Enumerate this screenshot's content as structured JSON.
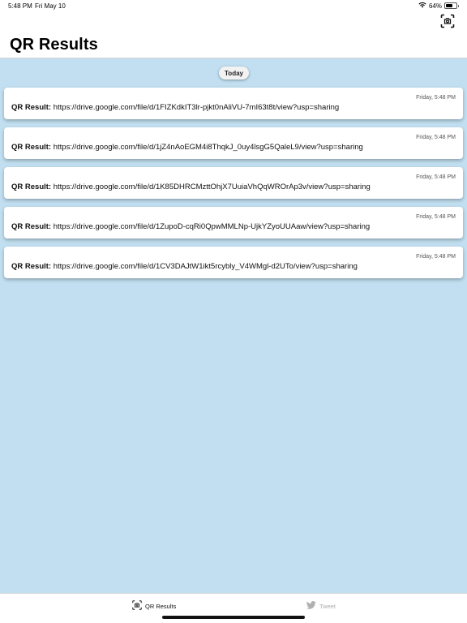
{
  "status_bar": {
    "time": "5:48 PM",
    "date": "Fri May 10",
    "battery_percent": "64%",
    "battery_level": 0.64,
    "icons": [
      "wifi-icon",
      "battery-icon"
    ]
  },
  "header": {
    "title": "QR Results",
    "scan_icon": "scan-qr-icon"
  },
  "content": {
    "background_color": "#c1dff0",
    "date_header": "Today",
    "results": [
      {
        "label": "QR Result:",
        "url": "https://drive.google.com/file/d/1FIZKdkIT3lr-pjkt0nAliVU-7mI63t8t/view?usp=sharing",
        "time": "Friday, 5:48 PM"
      },
      {
        "label": "QR Result:",
        "url": "https://drive.google.com/file/d/1jZ4nAoEGM4i8ThqkJ_0uy4lsgG5QaleL9/view?usp=sharing",
        "time": "Friday, 5:48 PM"
      },
      {
        "label": "QR Result:",
        "url": "https://drive.google.com/file/d/1K85DHRCMzttOhjX7UuiaVhQqWROrAp3v/view?usp=sharing",
        "time": "Friday, 5:48 PM"
      },
      {
        "label": "QR Result:",
        "url": "https://drive.google.com/file/d/1ZupoD-cqRi0QpwMMLNp-UjkYZyoUUAaw/view?usp=sharing",
        "time": "Friday, 5:48 PM"
      },
      {
        "label": "QR Result:",
        "url": "https://drive.google.com/file/d/1CV3DAJtW1ikt5rcybly_V4WMgl-d2UTo/view?usp=sharing",
        "time": "Friday, 5:48 PM"
      }
    ]
  },
  "tab_bar": {
    "tabs": [
      {
        "label": "QR Results",
        "icon": "qr-results-icon",
        "active": true
      },
      {
        "label": "Tweet",
        "icon": "twitter-bird-icon",
        "active": false
      }
    ]
  }
}
